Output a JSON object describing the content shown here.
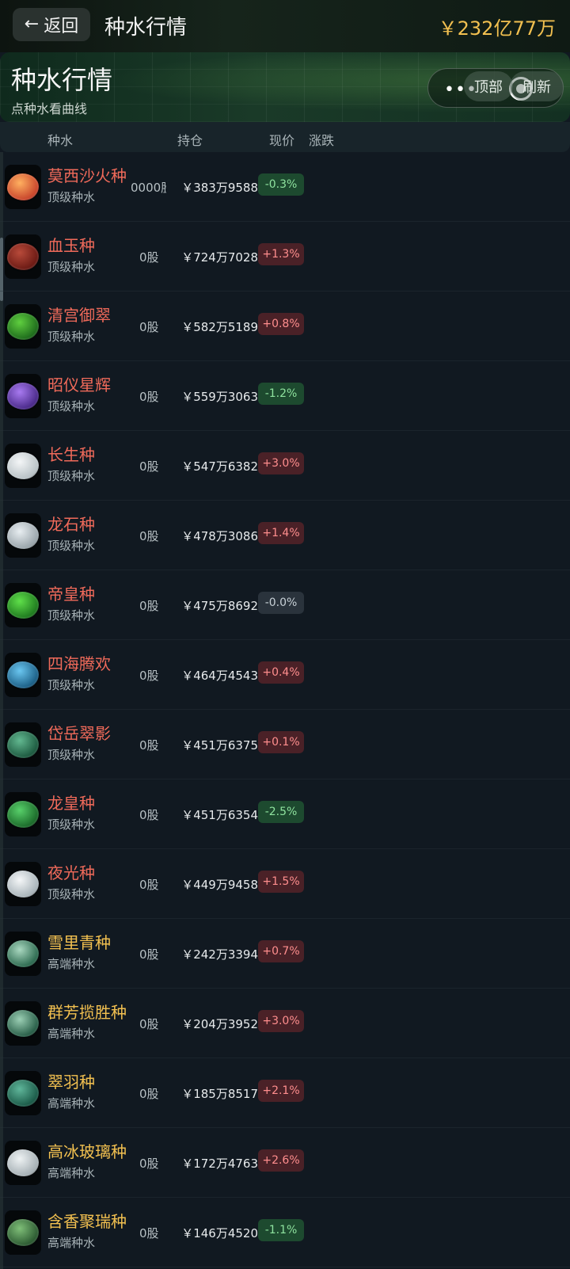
{
  "topbar": {
    "back_label": "返回",
    "title": "种水行情",
    "money": "￥232亿77万"
  },
  "header": {
    "title": "种水行情",
    "subtitle": "点种水看曲线",
    "capsule_dots": "•••",
    "btn_top": "顶部",
    "btn_refresh": "刷新"
  },
  "columns": {
    "c1": "种水",
    "c2": "持仓",
    "c3": "现价",
    "c4": "涨跌"
  },
  "rows": [
    {
      "name": "莫西沙火种",
      "grade": "顶级种水",
      "hold": "0000股",
      "price": "￥383万9588",
      "change": "-0.3%",
      "dir": "down",
      "color": "#c8452c",
      "color2": "#ffb060",
      "nameColor": "red"
    },
    {
      "name": "血玉种",
      "grade": "顶级种水",
      "hold": "0股",
      "price": "￥724万7028",
      "change": "+1.3%",
      "dir": "up",
      "color": "#6b1a14",
      "color2": "#b84a3a",
      "nameColor": "red"
    },
    {
      "name": "清宫御翠",
      "grade": "顶级种水",
      "hold": "0股",
      "price": "￥582万5189",
      "change": "+0.8%",
      "dir": "up",
      "color": "#1e6b1c",
      "color2": "#5fcf3f",
      "nameColor": "red"
    },
    {
      "name": "昭仪星辉",
      "grade": "顶级种水",
      "hold": "0股",
      "price": "￥559万3063",
      "change": "-1.2%",
      "dir": "down",
      "color": "#4a2a8a",
      "color2": "#a87af0",
      "nameColor": "red"
    },
    {
      "name": "长生种",
      "grade": "顶级种水",
      "hold": "0股",
      "price": "￥547万6382",
      "change": "+3.0%",
      "dir": "up",
      "color": "#b9c2c6",
      "color2": "#f4f6f7",
      "nameColor": "red"
    },
    {
      "name": "龙石种",
      "grade": "顶级种水",
      "hold": "0股",
      "price": "￥478万3086",
      "change": "+1.4%",
      "dir": "up",
      "color": "#9aa5ab",
      "color2": "#e8eef1",
      "nameColor": "red"
    },
    {
      "name": "帝皇种",
      "grade": "顶级种水",
      "hold": "0股",
      "price": "￥475万8692",
      "change": "-0.0%",
      "dir": "flat",
      "color": "#1f7a1f",
      "color2": "#5fe04a",
      "nameColor": "red"
    },
    {
      "name": "四海腾欢",
      "grade": "顶级种水",
      "hold": "0股",
      "price": "￥464万4543",
      "change": "+0.4%",
      "dir": "up",
      "color": "#1c5f86",
      "color2": "#6ac6f0",
      "nameColor": "red"
    },
    {
      "name": "岱岳翠影",
      "grade": "顶级种水",
      "hold": "0股",
      "price": "￥451万6375",
      "change": "+0.1%",
      "dir": "up",
      "color": "#1d5a40",
      "color2": "#62b890",
      "nameColor": "red"
    },
    {
      "name": "龙皇种",
      "grade": "顶级种水",
      "hold": "0股",
      "price": "￥451万6354",
      "change": "-2.5%",
      "dir": "down",
      "color": "#1b6a2a",
      "color2": "#58d06a",
      "nameColor": "red"
    },
    {
      "name": "夜光种",
      "grade": "顶级种水",
      "hold": "0股",
      "price": "￥449万9458",
      "change": "+1.5%",
      "dir": "up",
      "color": "#a9b4ba",
      "color2": "#f5f7f8",
      "nameColor": "red"
    },
    {
      "name": "雪里青种",
      "grade": "高端种水",
      "hold": "0股",
      "price": "￥242万3394",
      "change": "+0.7%",
      "dir": "up",
      "color": "#2d6a50",
      "color2": "#a9d8c0",
      "nameColor": "gold"
    },
    {
      "name": "群芳揽胜种",
      "grade": "高端种水",
      "hold": "0股",
      "price": "￥204万3952",
      "change": "+3.0%",
      "dir": "up",
      "color": "#285e48",
      "color2": "#9bcfb4",
      "nameColor": "gold"
    },
    {
      "name": "翠羽种",
      "grade": "高端种水",
      "hold": "0股",
      "price": "￥185万8517",
      "change": "+2.1%",
      "dir": "up",
      "color": "#1b5a48",
      "color2": "#5fb69a",
      "nameColor": "gold"
    },
    {
      "name": "高冰玻璃种",
      "grade": "高端种水",
      "hold": "0股",
      "price": "￥172万4763",
      "change": "+2.6%",
      "dir": "up",
      "color": "#a6b0b5",
      "color2": "#eef2f3",
      "nameColor": "gold"
    },
    {
      "name": "含香聚瑞种",
      "grade": "高端种水",
      "hold": "0股",
      "price": "￥146万4520",
      "change": "-1.1%",
      "dir": "down",
      "color": "#2c5a32",
      "color2": "#7fbf78",
      "nameColor": "gold"
    }
  ]
}
